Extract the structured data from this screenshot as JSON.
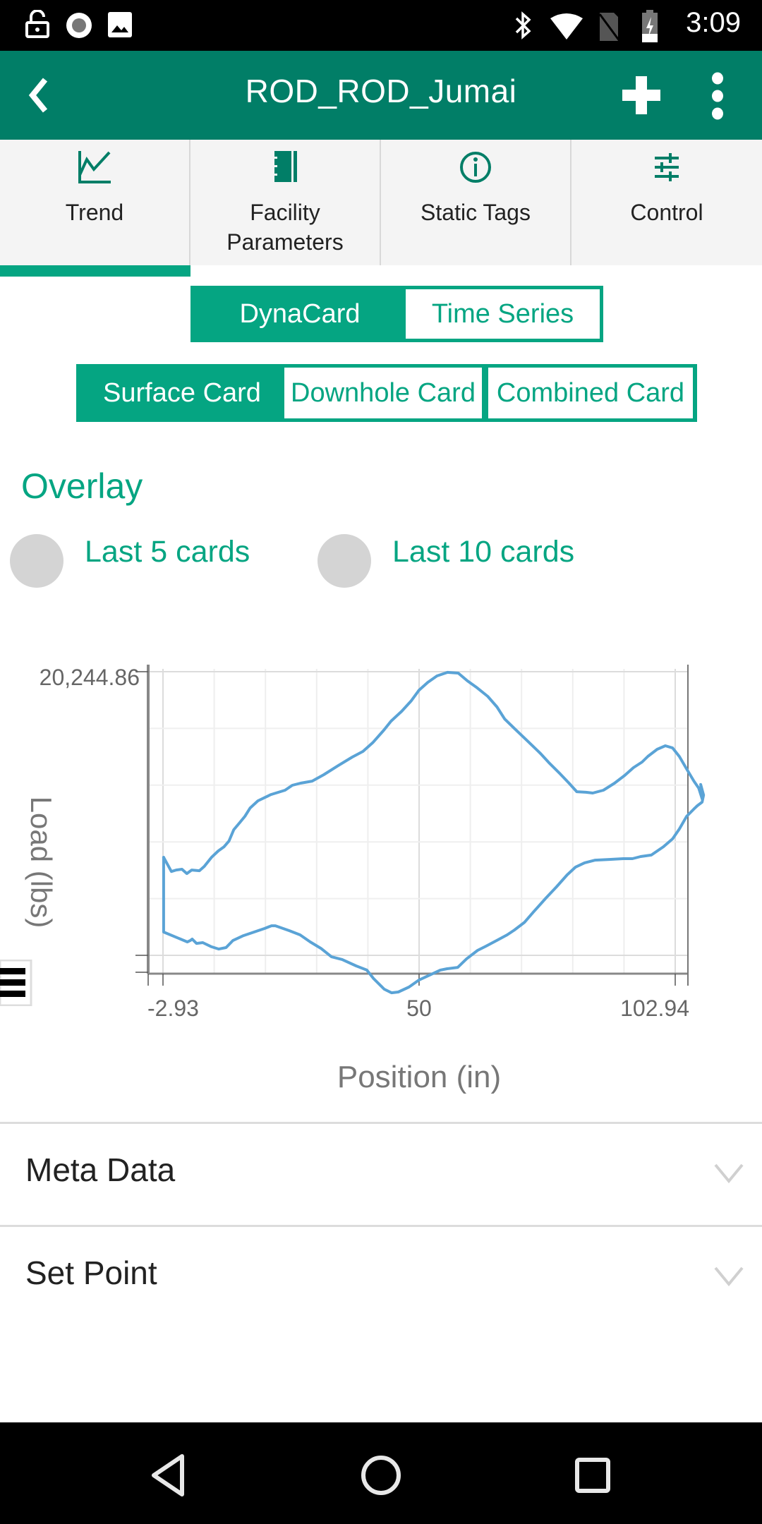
{
  "status_bar": {
    "time": "3:09",
    "left_icons": [
      "lock-open-icon",
      "record-icon",
      "image-icon"
    ],
    "right_icons": [
      "bluetooth-icon",
      "wifi-icon",
      "no-sim-icon",
      "battery-charging-icon"
    ]
  },
  "app_bar": {
    "title": "ROD_ROD_Jumai",
    "back_icon": "chevron-left-icon",
    "add_icon": "plus-icon",
    "more_icon": "more-vertical-icon"
  },
  "tabs": [
    {
      "label": "Trend",
      "icon": "trend-chart-icon",
      "active": true
    },
    {
      "label": "Facility\nParameters",
      "label_line1": "Facility",
      "label_line2": "Parameters",
      "icon": "notebook-icon",
      "active": false
    },
    {
      "label": "Static Tags",
      "icon": "info-icon",
      "active": false
    },
    {
      "label": "Control",
      "icon": "sliders-icon",
      "active": false
    }
  ],
  "view_toggle": {
    "options": [
      "DynaCard",
      "Time Series"
    ],
    "selected": "DynaCard"
  },
  "card_toggle": {
    "options": [
      "Surface Card",
      "Downhole Card",
      "Combined Card"
    ],
    "selected": "Surface Card"
  },
  "overlay": {
    "title": "Overlay",
    "options": [
      {
        "label": "Last 5 cards",
        "checked": false
      },
      {
        "label": "Last 10 cards",
        "checked": false
      }
    ]
  },
  "colors": {
    "primary_dark": "#017e67",
    "accent": "#05a582",
    "series": "#5aa3d6",
    "radio_off": "#d4d4d4"
  },
  "chart_data": {
    "type": "line",
    "title": "",
    "xlabel": "Position (in)",
    "ylabel": "Load (lbs)",
    "x_ticks": [
      "-2.93",
      "50",
      "102.94"
    ],
    "y_ticks": [
      "20,244.86"
    ],
    "xlim": [
      -2.93,
      102.94
    ],
    "ylim": [
      0,
      20244.86
    ],
    "grid": true,
    "series": [
      {
        "name": "Surface Card",
        "color": "#5aa3d6",
        "points": [
          [
            -2.8,
            7800
          ],
          [
            -1.2,
            6850
          ],
          [
            -0.2,
            6950
          ],
          [
            1.0,
            7000
          ],
          [
            2.0,
            6710
          ],
          [
            3.0,
            6950
          ],
          [
            4.6,
            6900
          ],
          [
            5.6,
            7190
          ],
          [
            7.1,
            7800
          ],
          [
            8.5,
            8230
          ],
          [
            9.7,
            8510
          ],
          [
            10.7,
            8890
          ],
          [
            11.7,
            9650
          ],
          [
            12.9,
            10120
          ],
          [
            14.0,
            10550
          ],
          [
            15.1,
            11110
          ],
          [
            16.7,
            11590
          ],
          [
            19.4,
            12010
          ],
          [
            22.3,
            12300
          ],
          [
            23.8,
            12630
          ],
          [
            25.5,
            12770
          ],
          [
            27.9,
            12910
          ],
          [
            30.3,
            13340
          ],
          [
            33.3,
            13950
          ],
          [
            36.2,
            14520
          ],
          [
            38.4,
            14900
          ],
          [
            40.5,
            15510
          ],
          [
            42.7,
            16320
          ],
          [
            44.2,
            16930
          ],
          [
            46.4,
            17590
          ],
          [
            48.4,
            18300
          ],
          [
            50.0,
            19010
          ],
          [
            51.8,
            19530
          ],
          [
            53.7,
            19960
          ],
          [
            55.9,
            20200
          ],
          [
            58.1,
            20150
          ],
          [
            60.0,
            19630
          ],
          [
            62.0,
            19160
          ],
          [
            64.2,
            18590
          ],
          [
            66.1,
            17880
          ],
          [
            67.7,
            17070
          ],
          [
            69.8,
            16410
          ],
          [
            72.7,
            15510
          ],
          [
            75.1,
            14760
          ],
          [
            77.0,
            14090
          ],
          [
            79.2,
            13380
          ],
          [
            81.0,
            12770
          ],
          [
            82.6,
            12200
          ],
          [
            84.5,
            12160
          ],
          [
            85.9,
            12110
          ],
          [
            88.1,
            12300
          ],
          [
            90.4,
            12770
          ],
          [
            92.5,
            13290
          ],
          [
            94.3,
            13810
          ],
          [
            96.1,
            14190
          ],
          [
            97.3,
            14570
          ],
          [
            99.2,
            15040
          ],
          [
            100.9,
            15280
          ],
          [
            102.4,
            15130
          ],
          [
            103.8,
            14560
          ],
          [
            105.3,
            13720
          ],
          [
            106.8,
            12910
          ],
          [
            107.8,
            12440
          ],
          [
            108.5,
            11730
          ]
        ]
      },
      {
        "name": "Surface Card (return)",
        "color": "#5aa3d6",
        "points": [
          [
            108.5,
            11730
          ],
          [
            108.2,
            12680
          ],
          [
            108.8,
            11970
          ],
          [
            108.5,
            11500
          ],
          [
            107.5,
            11260
          ],
          [
            106.8,
            11040
          ],
          [
            105.3,
            10550
          ],
          [
            103.8,
            9700
          ],
          [
            102.4,
            9040
          ],
          [
            100.5,
            8510
          ],
          [
            98.0,
            7950
          ],
          [
            95.8,
            7850
          ],
          [
            94.1,
            7710
          ],
          [
            92.2,
            7710
          ],
          [
            89.3,
            7660
          ],
          [
            86.4,
            7610
          ],
          [
            84.2,
            7430
          ],
          [
            82.3,
            7140
          ],
          [
            80.6,
            6620
          ],
          [
            78.4,
            5820
          ],
          [
            76.2,
            5060
          ],
          [
            73.7,
            4160
          ],
          [
            71.8,
            3450
          ],
          [
            69.7,
            2930
          ],
          [
            68.2,
            2600
          ],
          [
            66.0,
            2220
          ],
          [
            63.8,
            1840
          ],
          [
            62.1,
            1560
          ],
          [
            59.8,
            990
          ],
          [
            58.0,
            420
          ],
          [
            55.8,
            330
          ],
          [
            54.4,
            240
          ],
          [
            52.2,
            -90
          ],
          [
            50.0,
            -420
          ],
          [
            47.9,
            -900
          ],
          [
            45.7,
            -1230
          ],
          [
            44.3,
            -1280
          ],
          [
            42.8,
            -1040
          ],
          [
            40.6,
            -330
          ],
          [
            39.2,
            240
          ],
          [
            37.0,
            520
          ],
          [
            34.1,
            950
          ],
          [
            31.9,
            1130
          ],
          [
            29.7,
            1700
          ],
          [
            27.5,
            2130
          ],
          [
            25.4,
            2600
          ],
          [
            23.2,
            2880
          ],
          [
            20.3,
            3210
          ],
          [
            19.5,
            3210
          ],
          [
            18.1,
            3030
          ],
          [
            15.9,
            2790
          ],
          [
            13.7,
            2550
          ],
          [
            11.5,
            2220
          ],
          [
            10.1,
            1750
          ],
          [
            8.6,
            1650
          ],
          [
            7.1,
            1800
          ],
          [
            5.3,
            2080
          ],
          [
            4.0,
            2030
          ],
          [
            3.1,
            2320
          ],
          [
            2.7,
            2220
          ],
          [
            2.1,
            2130
          ],
          [
            -2.8,
            2790
          ],
          [
            -2.8,
            3870
          ],
          [
            -2.8,
            7800
          ]
        ]
      }
    ]
  },
  "accordions": [
    {
      "label": "Meta Data",
      "expanded": false
    },
    {
      "label": "Set Point",
      "expanded": false
    }
  ],
  "nav_bar": {
    "buttons": [
      "back-triangle-icon",
      "home-circle-icon",
      "recents-square-icon"
    ]
  }
}
